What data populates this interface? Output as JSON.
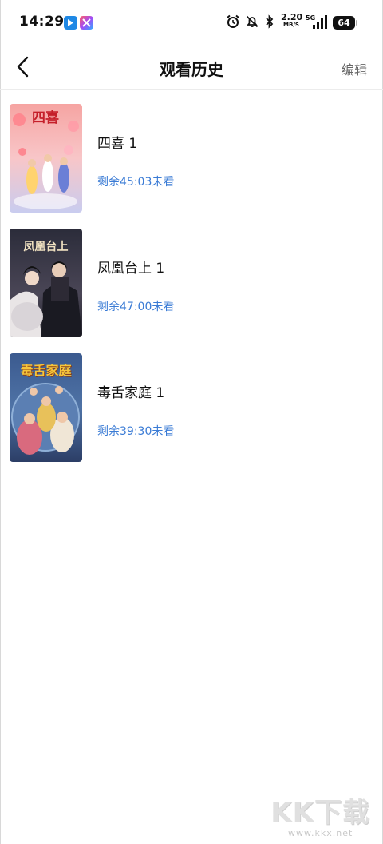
{
  "status_bar": {
    "time": "14:29",
    "net_speed": "2.20",
    "net_unit": "MB/S",
    "battery": "64",
    "icons": [
      "alarm-icon",
      "mute-icon",
      "bluetooth-icon",
      "5g-icon",
      "signal-icon",
      "battery-icon"
    ]
  },
  "nav": {
    "title": "观看历史",
    "edit_label": "编辑"
  },
  "history": [
    {
      "title": "四喜 1",
      "progress": "剩余45:03未看",
      "poster_text": "四喜"
    },
    {
      "title": "凤凰台上 1",
      "progress": "剩余47:00未看",
      "poster_text": "凤凰台上"
    },
    {
      "title": "毒舌家庭 1",
      "progress": "剩余39:30未看",
      "poster_text": "毒舌家庭"
    }
  ],
  "watermark": {
    "logo": "KK下载",
    "url": "www.kkx.net"
  },
  "colors": {
    "accent": "#3a7bd5",
    "title": "#111111",
    "muted": "#666666"
  }
}
